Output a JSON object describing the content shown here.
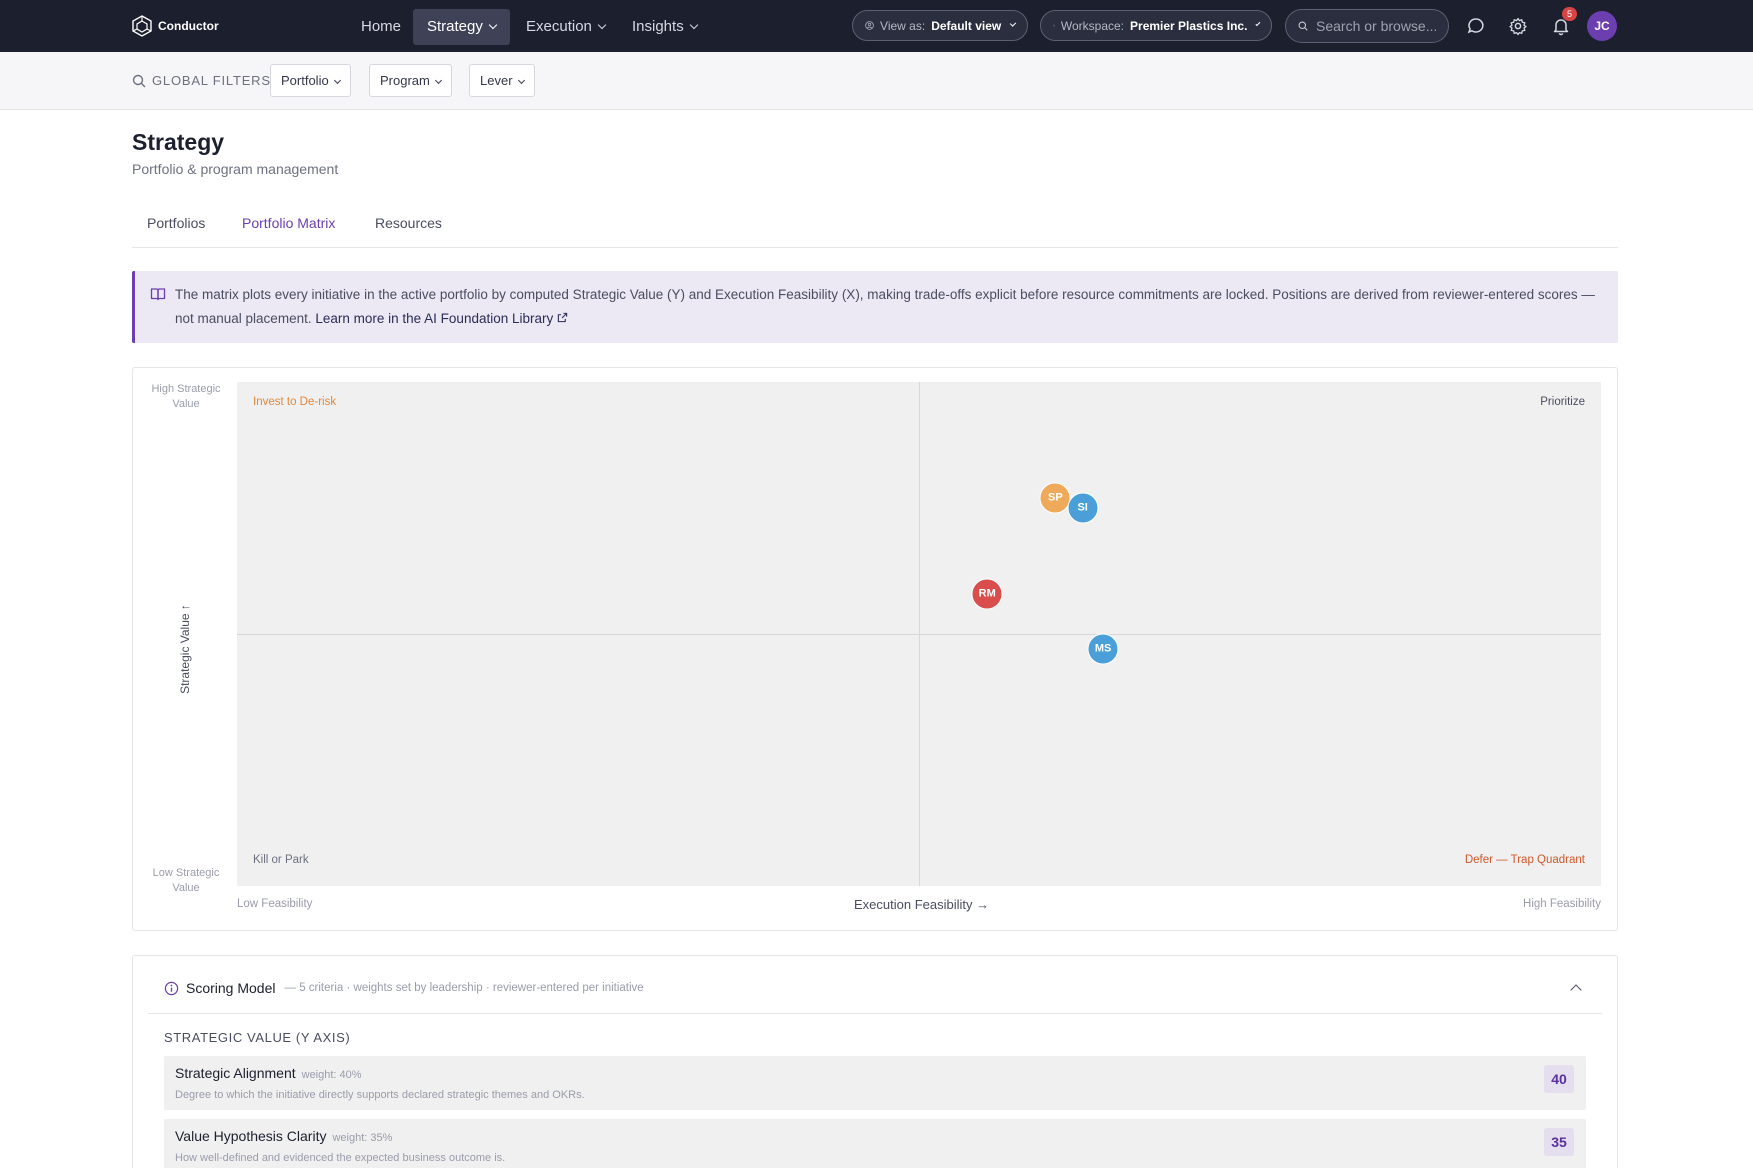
{
  "brand": {
    "name": "Conductor"
  },
  "nav": {
    "items": [
      {
        "label": "Home"
      },
      {
        "label": "Strategy"
      },
      {
        "label": "Execution"
      },
      {
        "label": "Insights"
      }
    ]
  },
  "header": {
    "view_as": {
      "label": "View as:",
      "value": "Default view"
    },
    "workspace": {
      "label": "Workspace:",
      "value": "Premier Plastics Inc."
    },
    "search": {
      "placeholder": "Search or browse..."
    },
    "notifications_count": "5",
    "user_initials": "JC"
  },
  "filters": {
    "label": "GLOBAL FILTERS",
    "items": [
      {
        "label": "Portfolio"
      },
      {
        "label": "Program"
      },
      {
        "label": "Lever"
      }
    ]
  },
  "page": {
    "title": "Strategy",
    "subtitle": "Portfolio & program management"
  },
  "tabs": [
    {
      "label": "Portfolios"
    },
    {
      "label": "Portfolio Matrix"
    },
    {
      "label": "Resources"
    }
  ],
  "banner": {
    "text": "The matrix plots every initiative in the active portfolio by computed Strategic Value (Y) and Execution Feasibility (X), making trade-offs explicit before resource commitments are locked. Positions are derived from reviewer-entered scores — not manual placement.",
    "link_text": "Learn more in the AI Foundation Library"
  },
  "chart_data": {
    "type": "scatter",
    "ylabel": "Strategic Value ↑",
    "xlabel": "Execution Feasibility →",
    "y_high_label": "High Strategic Value",
    "y_low_label": "Low Strategic Value",
    "x_low_label": "Low Feasibility",
    "x_high_label": "High Feasibility",
    "xlim": [
      0,
      100
    ],
    "ylim": [
      0,
      100
    ],
    "quadrants": {
      "top_left": "Invest to De-risk",
      "top_right": "Prioritize",
      "bottom_left": "Kill or Park",
      "bottom_right": "Defer — Trap Quadrant"
    },
    "points": [
      {
        "label": "SP",
        "x": 60,
        "y": 77,
        "color": "#eea95a"
      },
      {
        "label": "SI",
        "x": 62,
        "y": 75,
        "color": "#4a9fd9"
      },
      {
        "label": "RM",
        "x": 55,
        "y": 58,
        "color": "#d94d4d"
      },
      {
        "label": "MS",
        "x": 63.5,
        "y": 47,
        "color": "#4a9fd9"
      }
    ]
  },
  "scoring_model": {
    "title": "Scoring Model",
    "meta": "— 5 criteria · weights set by leadership · reviewer-entered per initiative",
    "section_title": "STRATEGIC VALUE (Y AXIS)",
    "criteria": [
      {
        "name": "Strategic Alignment",
        "weight": "weight: 40%",
        "description": "Degree to which the initiative directly supports declared strategic themes and OKRs.",
        "score": "40"
      },
      {
        "name": "Value Hypothesis Clarity",
        "weight": "weight: 35%",
        "description": "How well-defined and evidenced the expected business outcome is.",
        "score": "35"
      }
    ]
  },
  "colors": {
    "nav_bg": "#1c1f2e",
    "accent": "#6b3fb0",
    "invest_label": "#e0883a",
    "defer_label": "#d0582a",
    "plot_bg": "#f0f0f0"
  }
}
